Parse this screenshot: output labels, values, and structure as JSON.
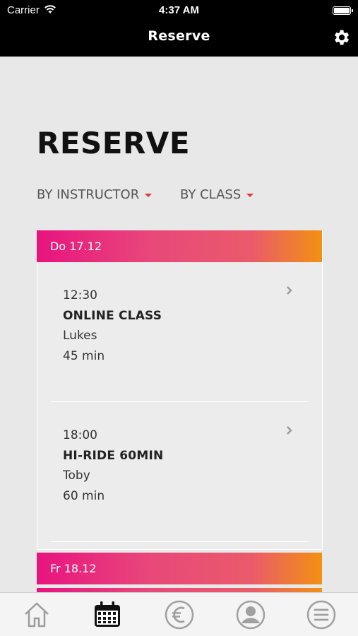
{
  "status_bar": {
    "carrier": "Carrier",
    "time": "4:37 AM"
  },
  "nav": {
    "title": "Reserve",
    "settings_icon": "gear-icon"
  },
  "page": {
    "heading": "RESERVE"
  },
  "filters": {
    "instructor_label": "BY INSTRUCTOR",
    "class_label": "BY CLASS"
  },
  "days": [
    {
      "date": "Do 17.12",
      "sessions": [
        {
          "time": "12:30",
          "title": "ONLINE CLASS",
          "instructor": "Lukes",
          "duration": "45 min"
        },
        {
          "time": "18:00",
          "title": "HI-RIDE 60MIN",
          "instructor": "Toby",
          "duration": "60 min"
        }
      ]
    },
    {
      "date": "Fr 18.12",
      "sessions": []
    }
  ],
  "tabs": [
    "home-icon",
    "calendar-icon",
    "euro-icon",
    "profile-icon",
    "menu-icon"
  ],
  "colors": {
    "gradient_start": "#e8137f",
    "gradient_end": "#f29111",
    "caret": "#e03a2e"
  }
}
